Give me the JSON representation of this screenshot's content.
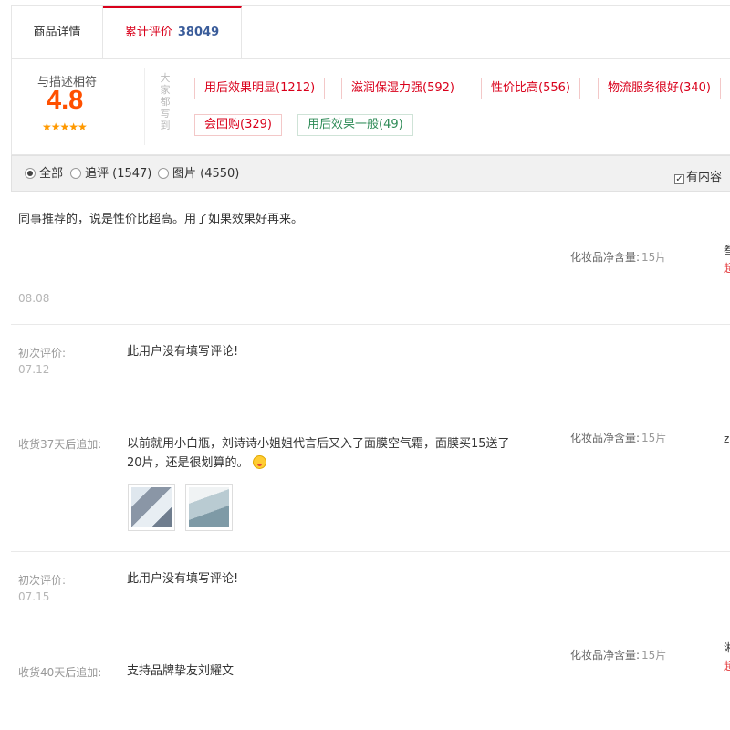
{
  "tabs": {
    "detail": "商品详情",
    "reviews": "累计评价",
    "review_count": "38049"
  },
  "summary": {
    "score_label": "与描述相符",
    "score": "4.8",
    "stars": "★★★★★",
    "side_label": "大家都写到",
    "tags": [
      {
        "label": "用后效果明显(1212)"
      },
      {
        "label": "滋润保湿力强(592)"
      },
      {
        "label": "性价比高(556)"
      },
      {
        "label": "物流服务很好(340)"
      },
      {
        "label": "会回购(329)"
      },
      {
        "label": "用后效果一般(49)"
      }
    ]
  },
  "filter": {
    "all": "全部",
    "append": "追评 (1547)",
    "pictures": "图片 (4550)",
    "has_content": "有内容"
  },
  "reviews": [
    {
      "text": "同事推荐的，说是性价比超高。用了如果效果好再来。",
      "sku_label": "化妆品净含量:",
      "sku_value": "15片",
      "date": "08.08",
      "cut_1": "叁",
      "cut_2": "超"
    },
    {
      "first_label": "初次评价:",
      "first_date": "07.12",
      "first_text": "此用户没有填写评论!",
      "append_label": "收货37天后追加:",
      "append_text_1": "以前就用小白瓶，刘诗诗小姐姐代言后又入了面膜空气霜，面膜买15送了",
      "append_text_2": "20片，还是很划算的。",
      "sku_label": "化妆品净含量:",
      "sku_value": "15片",
      "cut_1": "z"
    },
    {
      "first_label": "初次评价:",
      "first_date": "07.15",
      "first_text": "此用户没有填写评论!",
      "append_label": "收货40天后追加:",
      "append_text": "支持品牌挚友刘耀文",
      "sku_label": "化妆品净含量:",
      "sku_value": "15片",
      "cut_1": "湘",
      "cut_2": "超"
    }
  ]
}
